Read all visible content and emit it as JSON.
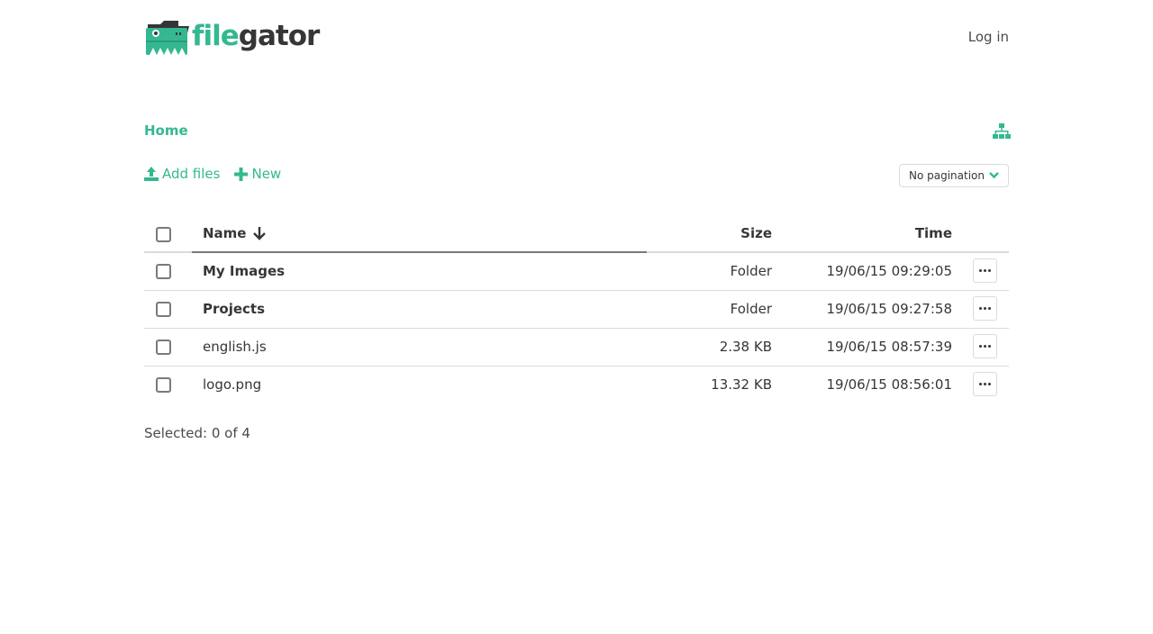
{
  "header": {
    "logo_part1": "file",
    "logo_part2": "gator",
    "login_label": "Log in"
  },
  "breadcrumb": {
    "home": "Home"
  },
  "toolbar": {
    "add_files_label": "Add files",
    "new_label": "New",
    "pagination_value": "No pagination"
  },
  "table": {
    "columns": {
      "name": "Name",
      "size": "Size",
      "time": "Time"
    },
    "rows": [
      {
        "name": "My Images",
        "size": "Folder",
        "time": "19/06/15 09:29:05",
        "is_folder": true
      },
      {
        "name": "Projects",
        "size": "Folder",
        "time": "19/06/15 09:27:58",
        "is_folder": true
      },
      {
        "name": "english.js",
        "size": "2.38 KB",
        "time": "19/06/15 08:57:39",
        "is_folder": false
      },
      {
        "name": "logo.png",
        "size": "13.32 KB",
        "time": "19/06/15 08:56:01",
        "is_folder": false
      }
    ]
  },
  "footer": {
    "selected_text": "Selected: 0 of 4"
  },
  "colors": {
    "accent": "#34b891",
    "text": "#363636",
    "border": "#dbdbdb"
  }
}
